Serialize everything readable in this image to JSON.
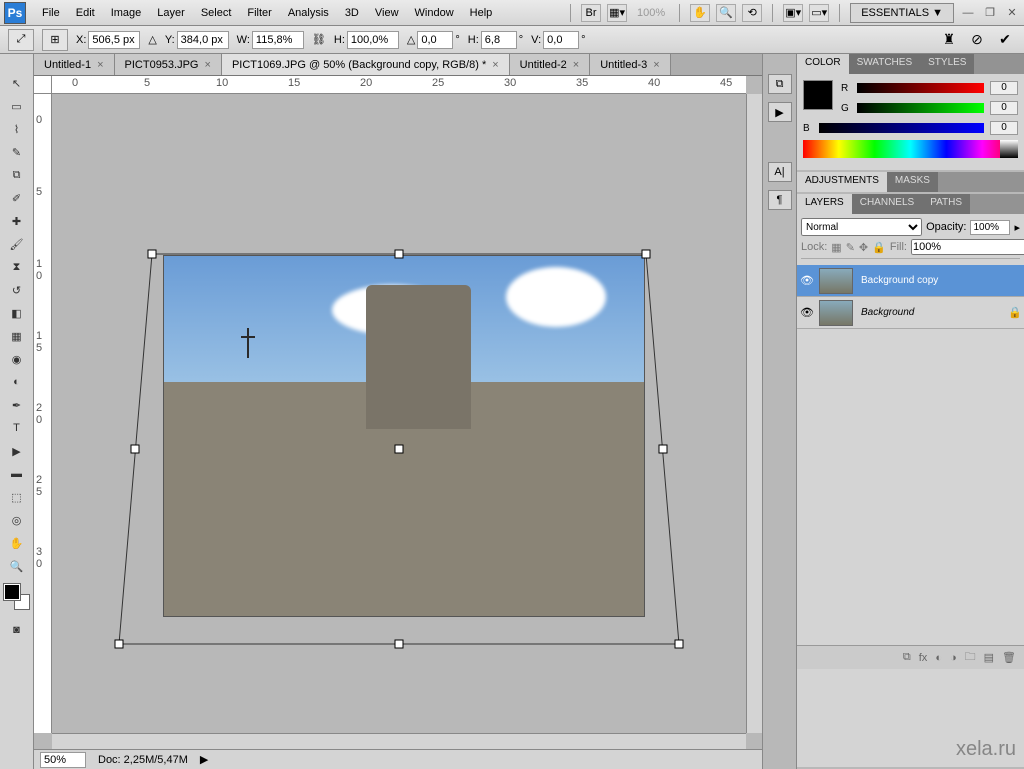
{
  "menubar": {
    "items": [
      "File",
      "Edit",
      "Image",
      "Layer",
      "Select",
      "Filter",
      "Analysis",
      "3D",
      "View",
      "Window",
      "Help"
    ],
    "zoom": "100%",
    "workspace": "ESSENTIALS ▼"
  },
  "optbar": {
    "x_label": "X:",
    "x": "506,5 px",
    "y_label": "Y:",
    "y": "384,0 px",
    "w_label": "W:",
    "w": "115,8%",
    "h_label": "H:",
    "h": "100,0%",
    "a_label": "△",
    "a": "0,0",
    "a_unit": "°",
    "sh_label": "H:",
    "sh": "6,8",
    "sh_unit": "°",
    "sv_label": "V:",
    "sv": "0,0",
    "sv_unit": "°"
  },
  "tabs": [
    {
      "label": "Untitled-1",
      "active": false
    },
    {
      "label": "PICT0953.JPG",
      "active": false
    },
    {
      "label": "PICT1069.JPG @ 50% (Background copy, RGB/8) *",
      "active": true
    },
    {
      "label": "Untitled-2",
      "active": false
    },
    {
      "label": "Untitled-3",
      "active": false
    }
  ],
  "ruler_h": [
    "0",
    "5",
    "10",
    "15",
    "20",
    "25",
    "30",
    "35",
    "40",
    "45"
  ],
  "ruler_v": [
    "0",
    "5",
    "1 0",
    "1 5",
    "2 0",
    "2 5",
    "3 0"
  ],
  "status": {
    "zoom": "50%",
    "doc": "Doc: 2,25M/5,47M"
  },
  "color_panel": {
    "tabs": [
      "COLOR",
      "SWATCHES",
      "STYLES"
    ],
    "r": "0",
    "g": "0",
    "b": "0"
  },
  "adjust_panel": {
    "tabs": [
      "ADJUSTMENTS",
      "MASKS"
    ]
  },
  "layers_panel": {
    "tabs": [
      "LAYERS",
      "CHANNELS",
      "PATHS"
    ],
    "blend": "Normal",
    "opacity_label": "Opacity:",
    "opacity": "100%",
    "lock_label": "Lock:",
    "fill_label": "Fill:",
    "fill": "100%",
    "items": [
      {
        "name": "Background copy",
        "selected": true,
        "locked": false
      },
      {
        "name": "Background",
        "selected": false,
        "locked": true
      }
    ]
  },
  "watermark": "xela.ru"
}
